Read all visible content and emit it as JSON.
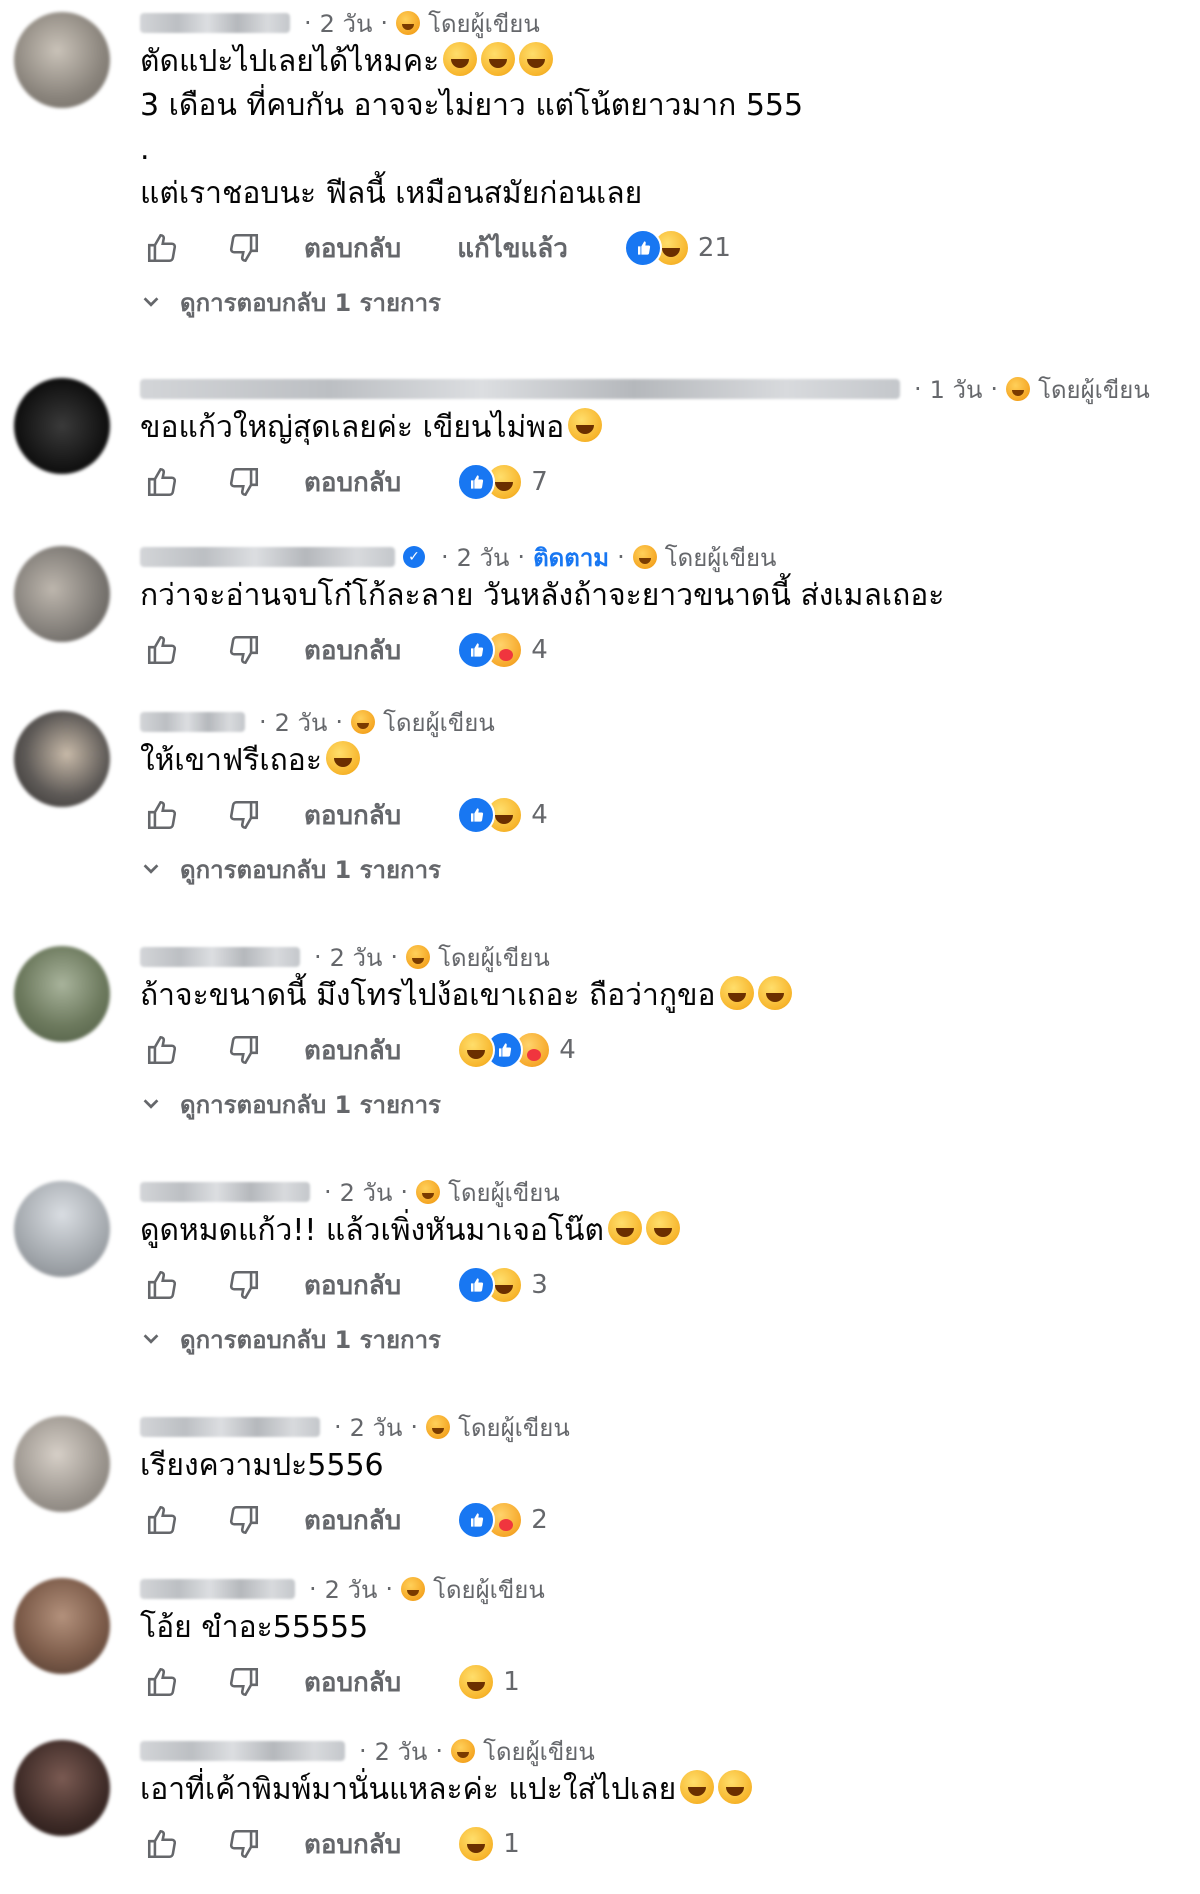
{
  "labels": {
    "reply": "ตอบกลับ",
    "edited": "แก้ไขแล้ว",
    "view_replies": "ดูการตอบกลับ 1 รายการ",
    "follow": "ติดตาม",
    "by_author": "โดยผู้เขียน"
  },
  "colors": {
    "meta_text": "#65676b",
    "body_text": "#050505",
    "link_blue": "#1877f2"
  },
  "comments": [
    {
      "time": "2 วัน",
      "lines": [
        "ตัดแปะไปเลยได้ไหมคะ",
        "3 เดือน ที่คบกัน อาจจะไม่ยาว แต่โน้ตยาวมาก 555",
        ".",
        "แต่เราชอบนะ ฟีลนี้ เหมือนสมัยก่อนเลย"
      ],
      "reaction_count": "21",
      "reactions": [
        "like-icon",
        "haha-icon"
      ],
      "edited": true,
      "replies": true
    },
    {
      "time": "1 วัน",
      "lines": [
        "ขอแก้วใหญ่สุดเลยค่ะ เขียนไม่พอ"
      ],
      "reaction_count": "7",
      "reactions": [
        "like-icon",
        "haha-icon"
      ],
      "edited": false,
      "replies": false
    },
    {
      "time": "2 วัน",
      "lines": [
        "กว่าจะอ่านจบโก๋โก้ละลาย วันหลังถ้าจะยาวขนาดนี้ ส่งเมลเถอะ"
      ],
      "reaction_count": "4",
      "reactions": [
        "like-icon",
        "care-icon"
      ],
      "edited": false,
      "replies": false,
      "verified": true,
      "follow": true
    },
    {
      "time": "2 วัน",
      "lines": [
        "ให้เขาฟรีเถอะ"
      ],
      "reaction_count": "4",
      "reactions": [
        "like-icon",
        "haha-icon"
      ],
      "edited": false,
      "replies": true
    },
    {
      "time": "2 วัน",
      "lines": [
        "ถ้าจะขนาดนี้ มึงโทรไปง้อเขาเถอะ ถือว่ากูขอ"
      ],
      "reaction_count": "4",
      "reactions": [
        "haha-icon",
        "like-icon",
        "care-icon"
      ],
      "edited": false,
      "replies": true
    },
    {
      "time": "2 วัน",
      "lines": [
        "ดูดหมดแก้ว!! แล้วเพิ่งหันมาเจอโน๊ต"
      ],
      "reaction_count": "3",
      "reactions": [
        "like-icon",
        "haha-icon"
      ],
      "edited": false,
      "replies": true
    },
    {
      "time": "2 วัน",
      "lines": [
        "เรียงความปะ5556"
      ],
      "reaction_count": "2",
      "reactions": [
        "like-icon",
        "care-icon"
      ],
      "edited": false,
      "replies": false
    },
    {
      "time": "2 วัน",
      "lines": [
        "โอ้ย ขำอะ55555"
      ],
      "reaction_count": "1",
      "reactions": [
        "haha-icon"
      ],
      "edited": false,
      "replies": false
    },
    {
      "time": "2 วัน",
      "lines": [
        "เอาที่เค้าพิมพ์มานั่นแหละค่ะ แปะใส่ไปเลย"
      ],
      "reaction_count": "1",
      "reactions": [
        "haha-icon"
      ],
      "edited": false,
      "replies": false
    }
  ]
}
